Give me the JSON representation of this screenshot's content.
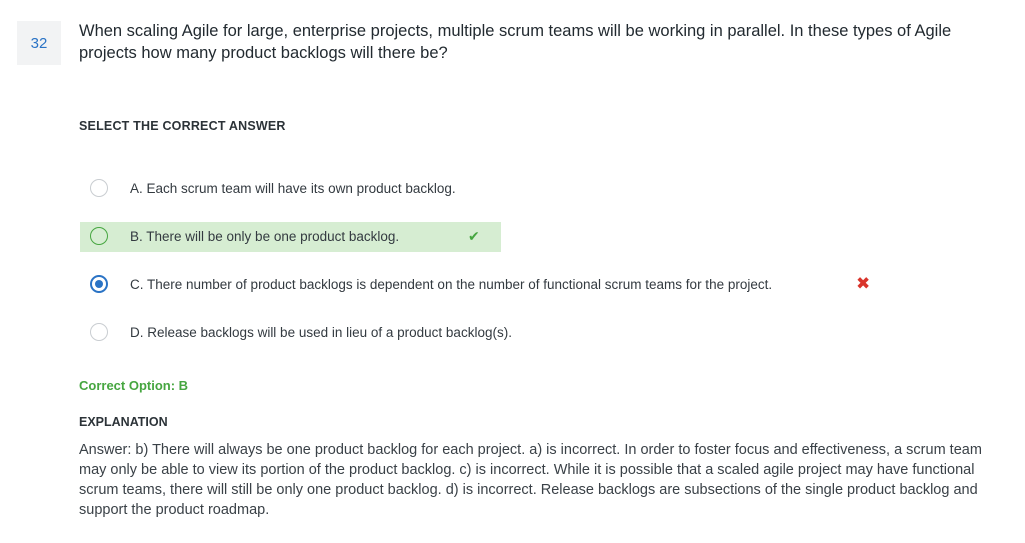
{
  "question": {
    "number": "32",
    "text": "When scaling Agile for large, enterprise projects, multiple scrum teams will be working in parallel. In these types of Agile projects how many product backlogs will there be?"
  },
  "select_label": "SELECT THE CORRECT ANSWER",
  "options": [
    {
      "label": "A. Each scrum team will have its own product backlog.",
      "state": "unselected"
    },
    {
      "label": "B. There will be only be one product backlog.",
      "state": "correct"
    },
    {
      "label": "C. There number of product backlogs is dependent on the number of functional scrum teams for the project.",
      "state": "selected-incorrect"
    },
    {
      "label": "D. Release backlogs will be used in lieu of a product backlog(s).",
      "state": "unselected"
    }
  ],
  "icons": {
    "correct": "check-icon",
    "incorrect": "cross-icon"
  },
  "correct_option": "Correct Option: B",
  "explanation": {
    "label": "EXPLANATION",
    "text": "Answer: b) There will always be one product backlog for each project. a) is incorrect. In order to foster focus and effectiveness, a scrum team may only be able to view its portion of the product backlog. c) is incorrect. While it is possible that a scaled agile project may have functional scrum teams, there will still be only one product backlog. d) is incorrect. Release backlogs are subsections of the single product backlog and support the product roadmap."
  },
  "colors": {
    "accent": "#2a73c5",
    "correct_bg": "#d6edd2",
    "correct_text": "#46a640",
    "incorrect": "#d9342b"
  }
}
